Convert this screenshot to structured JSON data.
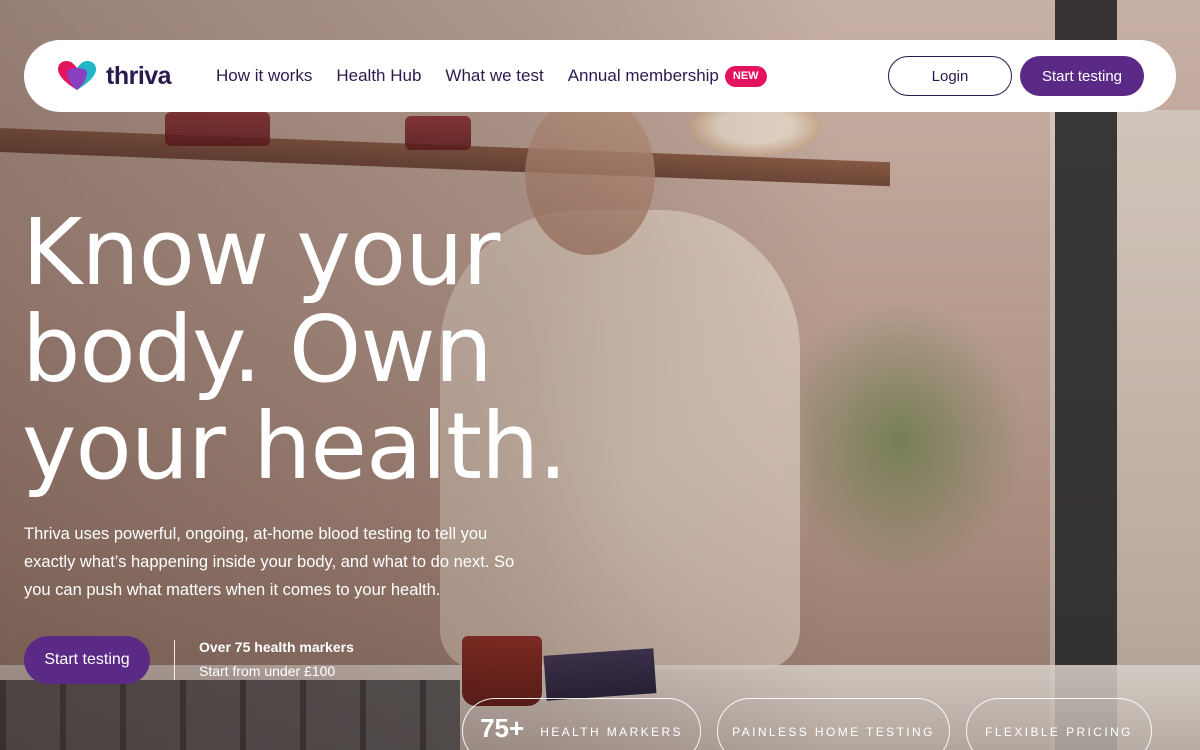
{
  "brand": {
    "name": "thriva",
    "logo_colors": [
      "#e4135f",
      "#8a3fc0",
      "#1fb6c8"
    ]
  },
  "nav": {
    "links": [
      {
        "label": "How it works"
      },
      {
        "label": "Health Hub"
      },
      {
        "label": "What we test"
      },
      {
        "label": "Annual membership",
        "badge": "NEW"
      }
    ],
    "login_label": "Login",
    "start_label": "Start testing"
  },
  "hero": {
    "headline": "Know your body. Own your health.",
    "subtext": "Thriva uses powerful, ongoing, at-home blood testing to tell you exactly what’s happening inside your body, and what to do next. So you can push what matters when it comes to your health.",
    "cta_label": "Start testing",
    "markers_title": "Over 75 health markers",
    "markers_price": "Start from under £100"
  },
  "pills": [
    {
      "big": "75+",
      "label": "HEALTH MARKERS"
    },
    {
      "label": "PAINLESS HOME TESTING"
    },
    {
      "label": "FLEXIBLE PRICING"
    }
  ],
  "colors": {
    "accent": "#5b2a86",
    "badge": "#e4135f",
    "nav_text": "#2b1a4e"
  }
}
